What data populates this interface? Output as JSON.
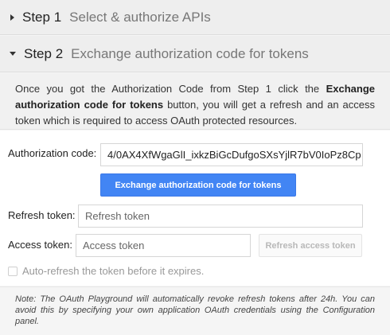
{
  "step1": {
    "number": "Step 1",
    "title": "Select & authorize APIs"
  },
  "step2": {
    "number": "Step 2",
    "title": "Exchange authorization code for tokens"
  },
  "description": {
    "part1": "Once you got the Authorization Code from Step 1 click the ",
    "bold": "Exchange authorization code for tokens",
    "part2": " button, you will get a refresh and an access token which is required to access OAuth protected resources."
  },
  "auth_code": {
    "label": "Authorization code:",
    "value": "4/0AX4XfWgaGlI_ixkzBiGcDufgoSXsYjlR7bV0IoPz8Cp"
  },
  "exchange_button": "Exchange authorization code for tokens",
  "refresh_token": {
    "label": "Refresh token:",
    "placeholder": "Refresh token"
  },
  "access_token": {
    "label": "Access token:",
    "placeholder": "Access token"
  },
  "refresh_access_button": "Refresh access token",
  "auto_refresh": {
    "label": "Auto-refresh the token before it expires.",
    "checked": false
  },
  "note": "Note: The OAuth Playground will automatically revoke refresh tokens after 24h. You can avoid this by specifying your own application OAuth credentials using the Configuration panel."
}
